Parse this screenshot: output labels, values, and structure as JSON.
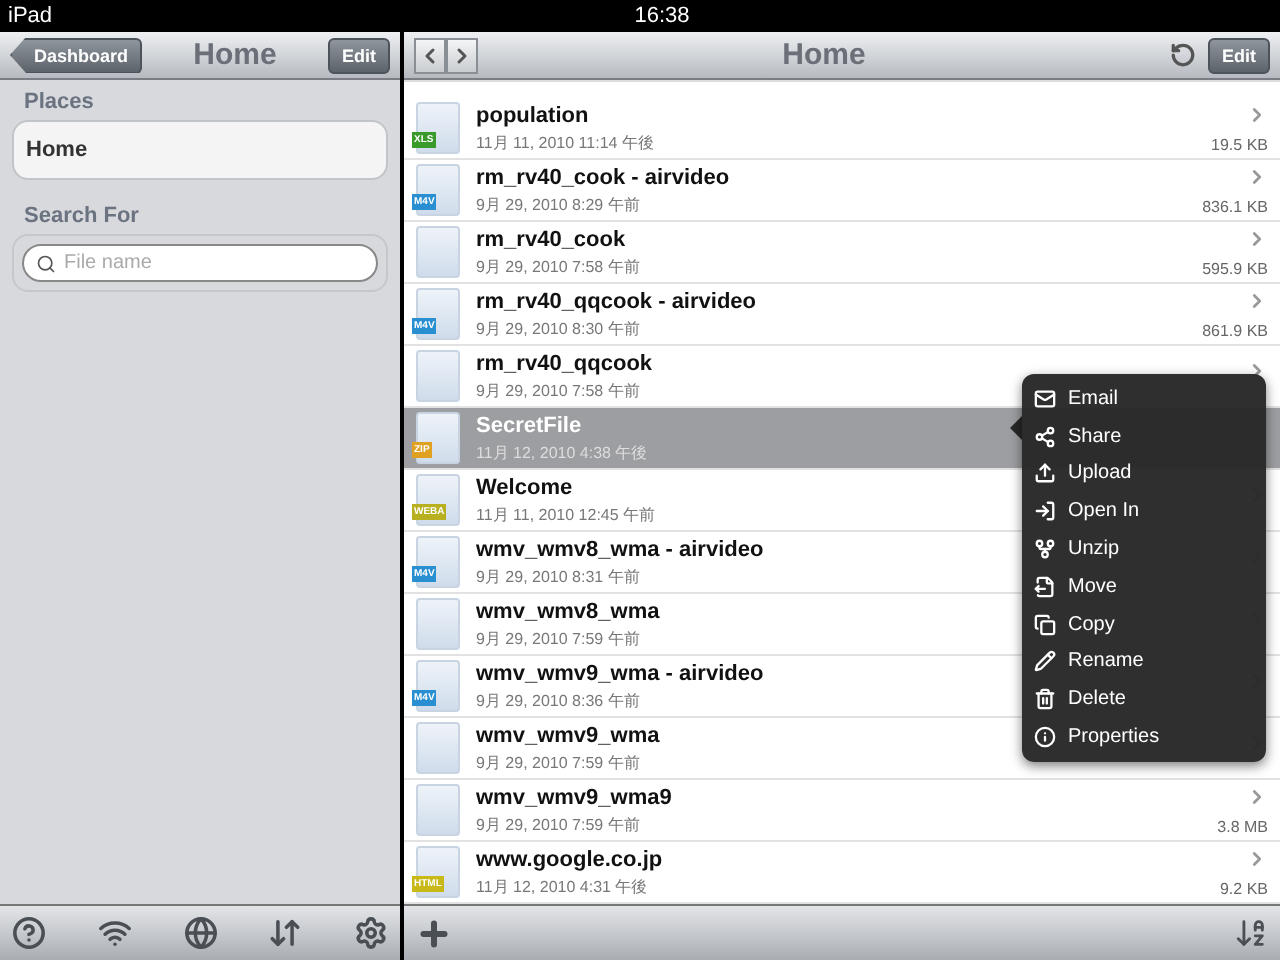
{
  "status_bar": {
    "device": "iPad",
    "time": "16:38"
  },
  "sidebar": {
    "back": "Dashboard",
    "title": "Home",
    "edit": "Edit",
    "places_heading": "Places",
    "places": [
      {
        "label": "Home",
        "selected": true
      }
    ],
    "search_heading": "Search For",
    "search": {
      "placeholder": "File name"
    }
  },
  "main": {
    "title": "Home",
    "edit": "Edit",
    "files": [
      {
        "name": "population",
        "date": "11月 11, 2010 11:14 午後",
        "size": "19.5 KB",
        "badge": "XLS",
        "color": "#3a9a2a",
        "selected": false
      },
      {
        "name": "rm_rv40_cook - airvideo",
        "date": "9月 29, 2010 8:29 午前",
        "size": "836.1 KB",
        "badge": "M4V",
        "color": "#2a8fd0",
        "selected": false
      },
      {
        "name": "rm_rv40_cook",
        "date": "9月 29, 2010 7:58 午前",
        "size": "595.9 KB",
        "selected": false
      },
      {
        "name": "rm_rv40_qqcook - airvideo",
        "date": "9月 29, 2010 8:30 午前",
        "size": "861.9 KB",
        "badge": "M4V",
        "color": "#2a8fd0",
        "selected": false
      },
      {
        "name": "rm_rv40_qqcook",
        "date": "9月 29, 2010 7:58 午前",
        "selected": false
      },
      {
        "name": "SecretFile",
        "date": "11月 12, 2010 4:38 午後",
        "badge": "ZIP",
        "color": "#e0a020",
        "selected": true
      },
      {
        "name": "Welcome",
        "date": "11月 11, 2010 12:45 午前",
        "badge": "WEBA",
        "color": "#b8b020",
        "selected": false
      },
      {
        "name": "wmv_wmv8_wma - airvideo",
        "date": "9月 29, 2010 8:31 午前",
        "badge": "M4V",
        "color": "#2a8fd0",
        "selected": false
      },
      {
        "name": "wmv_wmv8_wma",
        "date": "9月 29, 2010 7:59 午前",
        "selected": false
      },
      {
        "name": "wmv_wmv9_wma - airvideo",
        "date": "9月 29, 2010 8:36 午前",
        "badge": "M4V",
        "color": "#2a8fd0",
        "selected": false
      },
      {
        "name": "wmv_wmv9_wma",
        "date": "9月 29, 2010 7:59 午前",
        "selected": false
      },
      {
        "name": "wmv_wmv9_wma9",
        "date": "9月 29, 2010 7:59 午前",
        "size": "3.8 MB",
        "selected": false
      },
      {
        "name": "www.google.co.jp",
        "date": "11月 12, 2010 4:31 午後",
        "size": "9.2 KB",
        "badge": "HTML",
        "color": "#c8b818",
        "selected": false
      }
    ]
  },
  "menu": [
    {
      "kind": "email",
      "label": "Email"
    },
    {
      "kind": "share",
      "label": "Share"
    },
    {
      "kind": "upload",
      "label": "Upload"
    },
    {
      "kind": "openin",
      "label": "Open In"
    },
    {
      "kind": "unzip",
      "label": "Unzip"
    },
    {
      "kind": "move",
      "label": "Move"
    },
    {
      "kind": "copy",
      "label": "Copy"
    },
    {
      "kind": "rename",
      "label": "Rename"
    },
    {
      "kind": "delete",
      "label": "Delete"
    },
    {
      "kind": "properties",
      "label": "Properties"
    }
  ]
}
